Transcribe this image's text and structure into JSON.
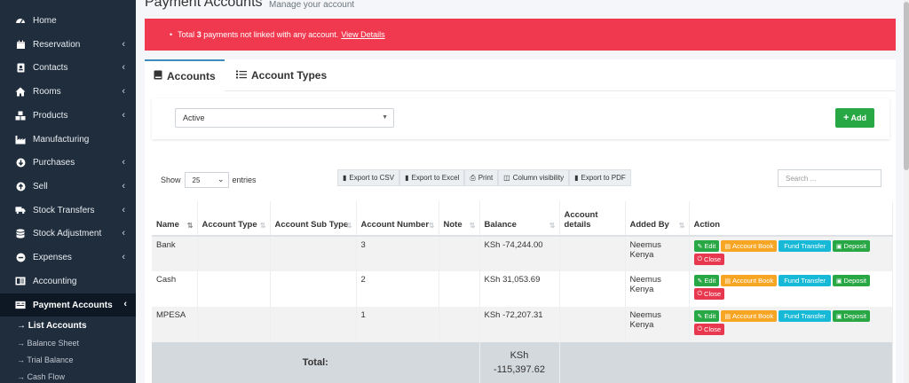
{
  "sidebar": {
    "items": [
      {
        "label": "Home",
        "icon": "dashboard-icon",
        "chevron": false
      },
      {
        "label": "Reservation",
        "icon": "calendar-icon",
        "chevron": true
      },
      {
        "label": "Contacts",
        "icon": "address-book-icon",
        "chevron": true
      },
      {
        "label": "Rooms",
        "icon": "home-icon",
        "chevron": true
      },
      {
        "label": "Products",
        "icon": "cubes-icon",
        "chevron": true
      },
      {
        "label": "Manufacturing",
        "icon": "industry-icon",
        "chevron": false
      },
      {
        "label": "Purchases",
        "icon": "arrow-circle-down-icon",
        "chevron": true
      },
      {
        "label": "Sell",
        "icon": "arrow-circle-up-icon",
        "chevron": true
      },
      {
        "label": "Stock Transfers",
        "icon": "truck-icon",
        "chevron": true
      },
      {
        "label": "Stock Adjustment",
        "icon": "database-icon",
        "chevron": true
      },
      {
        "label": "Expenses",
        "icon": "minus-circle-icon",
        "chevron": true
      },
      {
        "label": "Accounting",
        "icon": "book-icon",
        "chevron": false
      },
      {
        "label": "Payment Accounts",
        "icon": "money-check-icon",
        "chevron": true
      }
    ],
    "subitems": [
      {
        "label": "→ List Accounts"
      },
      {
        "label": "→ Balance Sheet"
      },
      {
        "label": "→ Trial Balance"
      },
      {
        "label": "→ Cash Flow"
      }
    ]
  },
  "header": {
    "title": "Payment Accounts",
    "subtitle": "Manage your account"
  },
  "alert": {
    "text_prefix": "Total",
    "count": "3",
    "text_suffix": "payments not linked with any account.",
    "link": "View Details"
  },
  "tabs": [
    {
      "label": "Accounts",
      "icon": "book-icon"
    },
    {
      "label": "Account Types",
      "icon": "list-icon"
    }
  ],
  "filter": {
    "status_value": "Active",
    "add_label": "Add"
  },
  "datatable": {
    "show_label": "Show",
    "entries_value": "25",
    "entries_label": "entries",
    "search_placeholder": "Search ...",
    "exports": [
      {
        "label": "Export to CSV",
        "icon": "file-csv-icon"
      },
      {
        "label": "Export to Excel",
        "icon": "file-excel-icon"
      },
      {
        "label": "Print",
        "icon": "print-icon"
      },
      {
        "label": "Column visibility",
        "icon": "columns-icon"
      },
      {
        "label": "Export to PDF",
        "icon": "file-pdf-icon"
      }
    ]
  },
  "table": {
    "headers": [
      "Name",
      "Account Type",
      "Account Sub Type",
      "Account Number",
      "Note",
      "Balance",
      "Account details",
      "Added By",
      "Action"
    ],
    "rows": [
      {
        "name": "Bank",
        "account_type": "",
        "account_sub_type": "",
        "account_number": "3",
        "note": "",
        "balance": "KSh -74,244.00",
        "account_details": "",
        "added_by": "Neemus Kenya"
      },
      {
        "name": "Cash",
        "account_type": "",
        "account_sub_type": "",
        "account_number": "2",
        "note": "",
        "balance": "KSh 31,053.69",
        "account_details": "",
        "added_by": "Neemus Kenya"
      },
      {
        "name": "MPESA",
        "account_type": "",
        "account_sub_type": "",
        "account_number": "1",
        "note": "",
        "balance": "KSh -72,207.31",
        "account_details": "",
        "added_by": "Neemus Kenya"
      }
    ],
    "actions": {
      "edit": "Edit",
      "account_book": "Account Book",
      "fund_transfer": "Fund Transfer",
      "deposit": "Deposit",
      "close": "Close"
    },
    "total_label": "Total:",
    "total_currency": "KSh",
    "total_value": "-115,397.62"
  },
  "colors": {
    "sidebar_bg": "#1f2d3d",
    "alert_bg": "#f0394f",
    "success": "#28a745",
    "warning": "#f7a623",
    "info": "#17b9d6",
    "danger": "#e8384f"
  }
}
